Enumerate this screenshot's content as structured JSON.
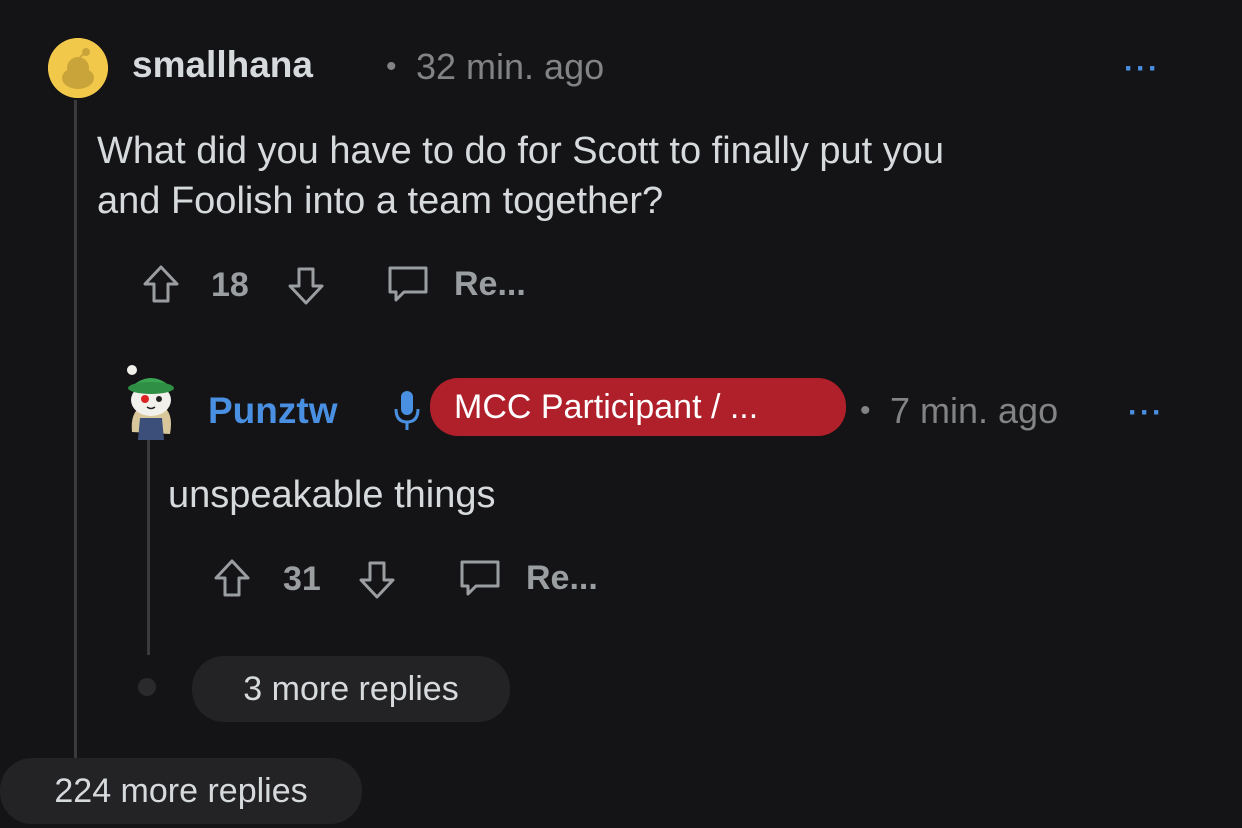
{
  "comment": {
    "username": "smallhana",
    "separator": "•",
    "time": "32 min. ago",
    "more": "···",
    "text_line1": "What did you have to do for Scott to finally put you",
    "text_line2": "and Foolish into a team together?",
    "upvotes": "18",
    "reply_label": "Re..."
  },
  "reply": {
    "username": "Punztw",
    "flair": "MCC Participant / ...",
    "separator": "•",
    "time": "7 min. ago",
    "more": "···",
    "text": "unspeakable things",
    "upvotes": "31",
    "reply_label": "Re...",
    "more_replies": "3 more replies"
  },
  "thread": {
    "more_replies": "224 more replies"
  },
  "colors": {
    "background": "#141416",
    "username_reply": "#4a90e2",
    "flair_bg": "#b0202a",
    "avatar_yellow": "#f2c84b"
  },
  "icons": {
    "upvote": "arrow-up-icon",
    "downvote": "arrow-down-icon",
    "comment": "speech-bubble-icon",
    "mic": "microphone-icon"
  }
}
